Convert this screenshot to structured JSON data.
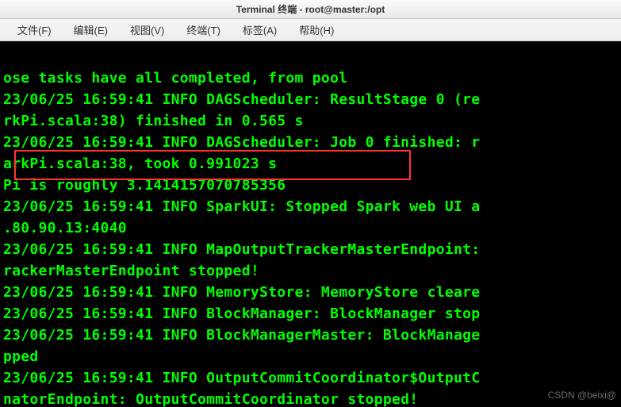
{
  "window": {
    "title": "Terminal 终端  -  root@master:/opt"
  },
  "menu": {
    "file": "文件(F)",
    "edit": "编辑(E)",
    "view": "视图(V)",
    "terminal": "终端(T)",
    "tab": "标签(A)",
    "help": "帮助(H)"
  },
  "terminal": {
    "line1": "ose tasks have all completed, from pool",
    "line2": "23/06/25 16:59:41 INFO DAGScheduler: ResultStage 0 (re",
    "line3": "rkPi.scala:38) finished in 0.565 s",
    "line4": "23/06/25 16:59:41 INFO DAGScheduler: Job 0 finished: r",
    "line5": "arkPi.scala:38, took 0.991023 s",
    "line6": "Pi is roughly 3.1414157070785356",
    "line7": "23/06/25 16:59:41 INFO SparkUI: Stopped Spark web UI a",
    "line8": ".80.90.13:4040",
    "line9": "23/06/25 16:59:41 INFO MapOutputTrackerMasterEndpoint:",
    "line10": "rackerMasterEndpoint stopped!",
    "line11": "23/06/25 16:59:41 INFO MemoryStore: MemoryStore cleare",
    "line12": "23/06/25 16:59:41 INFO BlockManager: BlockManager stop",
    "line13": "23/06/25 16:59:41 INFO BlockManagerMaster: BlockManage",
    "line14": "pped",
    "line15": "23/06/25 16:59:41 INFO OutputCommitCoordinator$OutputC",
    "line16": "natorEndpoint: OutputCommitCoordinator stopped!"
  },
  "watermark": "CSDN @beixi@"
}
